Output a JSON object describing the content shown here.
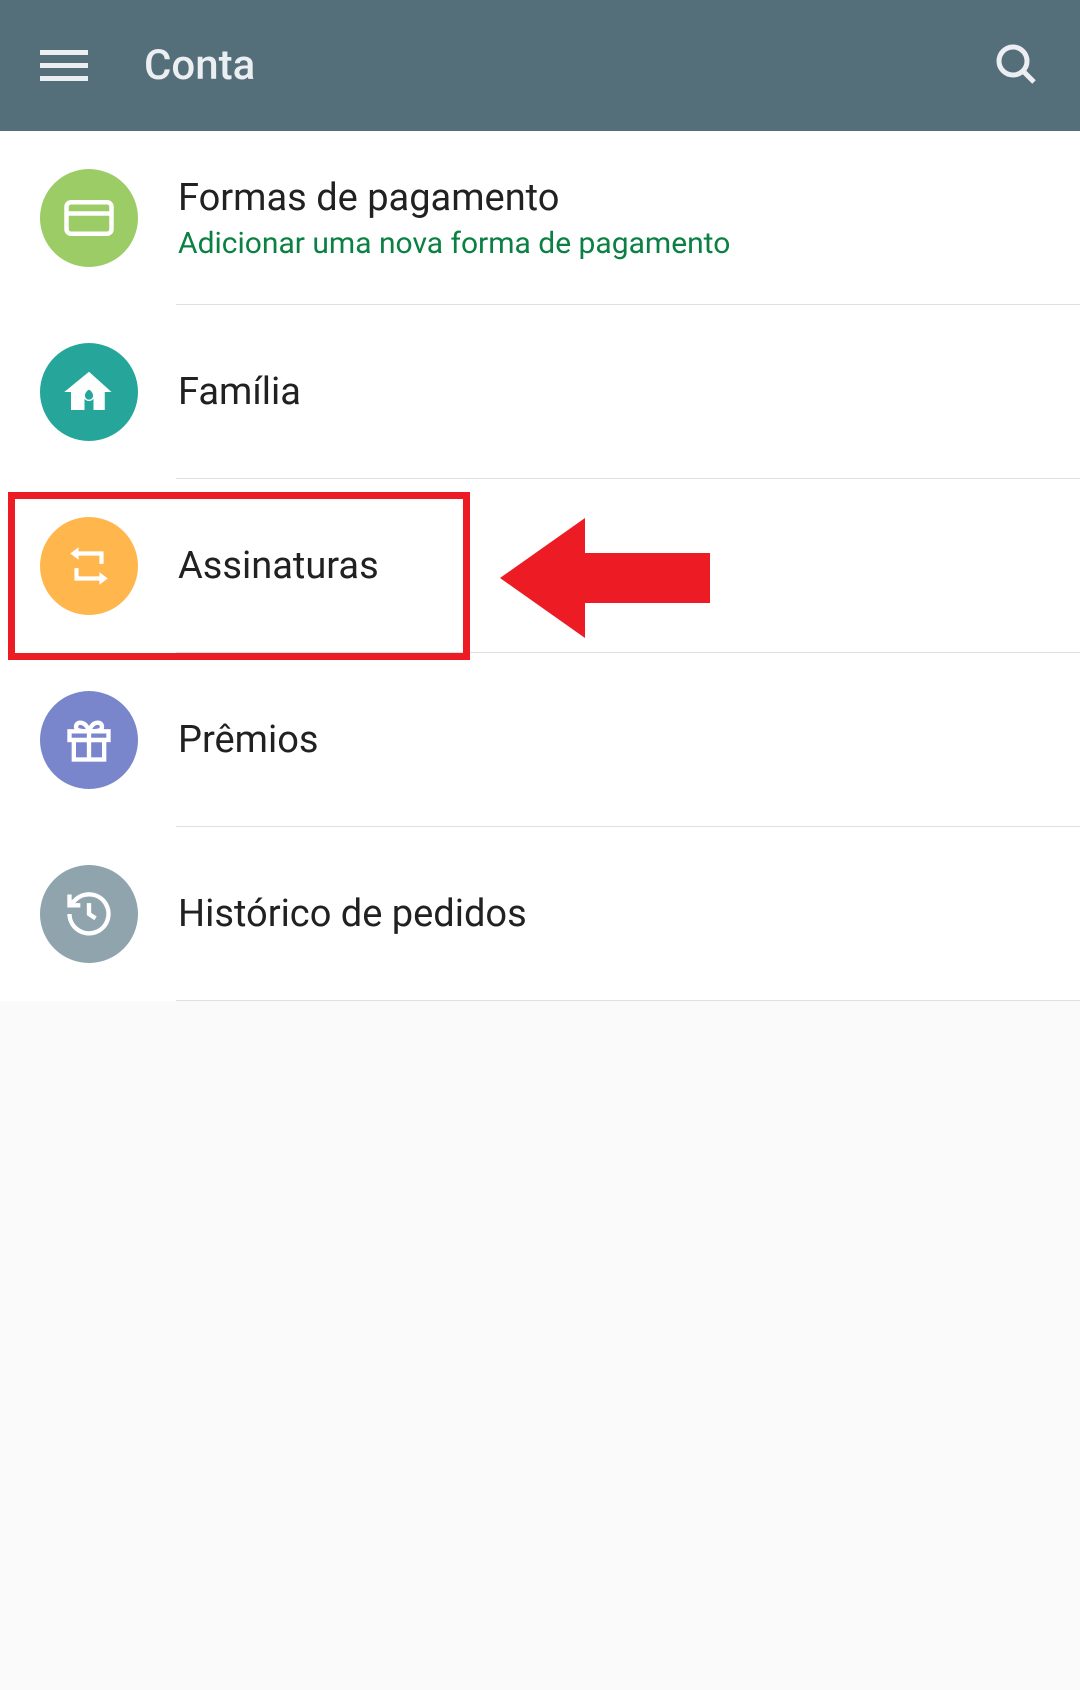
{
  "header": {
    "title": "Conta"
  },
  "menu": {
    "items": [
      {
        "title": "Formas de pagamento",
        "subtitle": "Adicionar uma nova forma de pagamento",
        "icon": "card-icon",
        "bgColor": "bg-green"
      },
      {
        "title": "Família",
        "subtitle": null,
        "icon": "home-icon",
        "bgColor": "bg-teal"
      },
      {
        "title": "Assinaturas",
        "subtitle": null,
        "icon": "refresh-icon",
        "bgColor": "bg-orange"
      },
      {
        "title": "Prêmios",
        "subtitle": null,
        "icon": "gift-icon",
        "bgColor": "bg-purple"
      },
      {
        "title": "Histórico de pedidos",
        "subtitle": null,
        "icon": "history-icon",
        "bgColor": "bg-gray"
      }
    ]
  }
}
